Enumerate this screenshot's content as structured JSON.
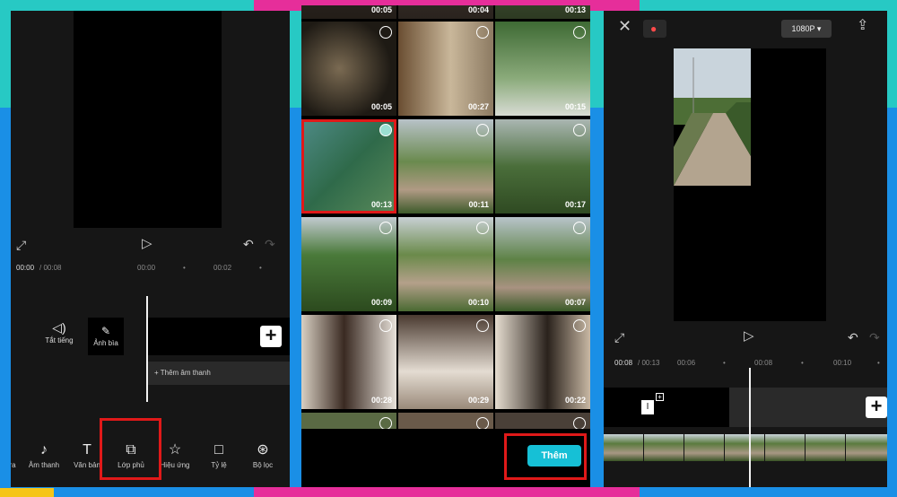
{
  "colors": {
    "accent_teal": "#16c0d6",
    "highlight_red": "#e01919",
    "panel_bg": "#161616"
  },
  "left": {
    "time_current": "00:00",
    "time_total": "/ 00:08",
    "ticks": [
      "00:00",
      "00:02"
    ],
    "mute_label": "Tắt tiếng",
    "cover_label": "Ảnh bìa",
    "add_audio_label": "Thêm âm thanh",
    "tools": [
      {
        "label": "ra",
        "icon": "partial-icon"
      },
      {
        "label": "Âm thanh",
        "icon": "music-note-icon"
      },
      {
        "label": "Văn bản",
        "icon": "text-icon"
      },
      {
        "label": "Lớp phủ",
        "icon": "overlay-icon"
      },
      {
        "label": "Hiệu ứng",
        "icon": "effects-icon"
      },
      {
        "label": "Tỷ lệ",
        "icon": "aspect-ratio-icon"
      },
      {
        "label": "Bộ lọc",
        "icon": "filter-icon"
      }
    ]
  },
  "gallery": {
    "top_row": [
      "00:05",
      "00:04",
      "00:13"
    ],
    "items": [
      {
        "duration": "00:05"
      },
      {
        "duration": "00:27"
      },
      {
        "duration": "00:15"
      },
      {
        "duration": "00:13",
        "selected": true
      },
      {
        "duration": "00:11"
      },
      {
        "duration": "00:17"
      },
      {
        "duration": "00:09"
      },
      {
        "duration": "00:10"
      },
      {
        "duration": "00:07"
      },
      {
        "duration": "00:28"
      },
      {
        "duration": "00:29"
      },
      {
        "duration": "00:22"
      }
    ],
    "add_button": "Thêm"
  },
  "right": {
    "resolution": "1080P",
    "time_current": "00:08",
    "time_total": "/ 00:13",
    "ticks": [
      "00:06",
      "00:08",
      "00:10"
    ]
  }
}
